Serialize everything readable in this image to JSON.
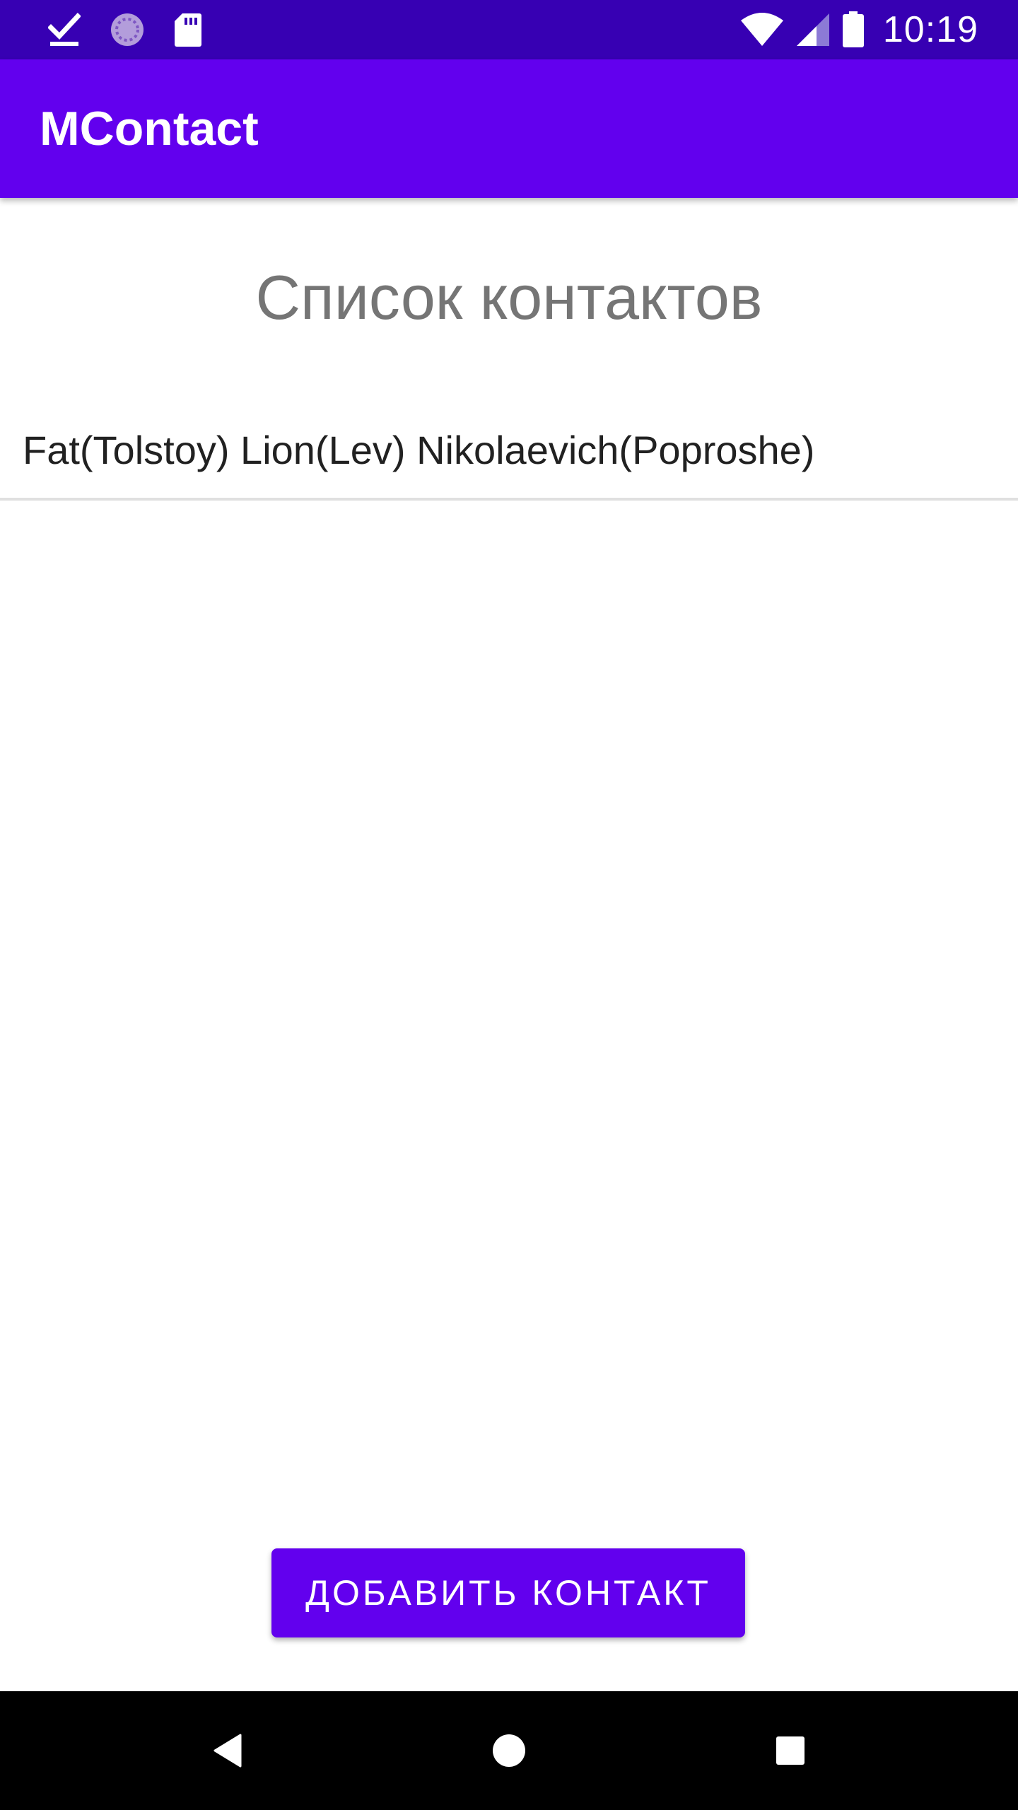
{
  "status_bar": {
    "time": "10:19",
    "left_icons": [
      "download-done-icon",
      "sync-icon",
      "sd-card-icon"
    ],
    "right_icons": [
      "wifi-icon",
      "cell-signal-icon",
      "battery-icon"
    ]
  },
  "app_bar": {
    "title": "MContact"
  },
  "main": {
    "heading": "Список контактов",
    "contacts": [
      {
        "name": "Fat(Tolstoy) Lion(Lev) Nikolaevich(Poproshe)"
      }
    ],
    "add_button_label": "ДОБАВИТЬ КОНТАКТ"
  },
  "nav_bar": {
    "buttons": [
      "back-icon",
      "home-icon",
      "recents-icon"
    ]
  },
  "colors": {
    "status_bar": "#3700b3",
    "primary": "#6200ee",
    "heading_text": "#757575",
    "divider": "#e0e0e0"
  }
}
